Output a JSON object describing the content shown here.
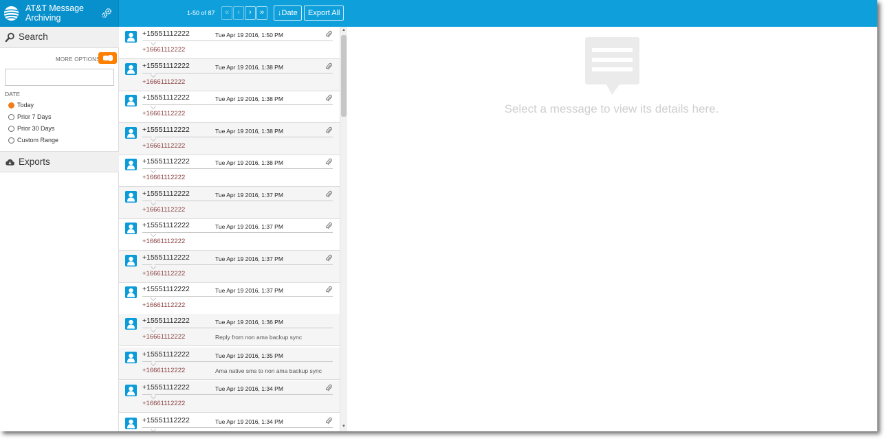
{
  "app": {
    "title": "AT&T Message Archiving"
  },
  "colors": {
    "header": "#0fa0dc",
    "accent": "#ff7f00",
    "avatar": "#0a9bd9",
    "recipient": "#8a3f3f"
  },
  "toolbar": {
    "page_count": "1-50 of 87",
    "first_icon": "«",
    "prev_icon": "‹",
    "next_icon": "›",
    "last_icon": "»",
    "sort_label": "Date",
    "export_all_label": "Export All"
  },
  "sidebar": {
    "search_label": "Search",
    "more_options_label": "MORE OPTIONS",
    "search_value": "",
    "date_label": "DATE",
    "date_options": [
      "Today",
      "Prior 7 Days",
      "Prior 30 Days",
      "Custom Range"
    ],
    "selected_date": "Today",
    "exports_label": "Exports"
  },
  "messages": [
    {
      "sender": "+15551112222",
      "date": "Tue Apr 19 2016, 1:50 PM",
      "recipient": "+16661112222",
      "snippet": "",
      "attachment": true
    },
    {
      "sender": "+15551112222",
      "date": "Tue Apr 19 2016, 1:38 PM",
      "recipient": "+16661112222",
      "snippet": "",
      "attachment": true
    },
    {
      "sender": "+15551112222",
      "date": "Tue Apr 19 2016, 1:38 PM",
      "recipient": "+16661112222",
      "snippet": "",
      "attachment": true
    },
    {
      "sender": "+15551112222",
      "date": "Tue Apr 19 2016, 1:38 PM",
      "recipient": "+16661112222",
      "snippet": "",
      "attachment": true
    },
    {
      "sender": "+15551112222",
      "date": "Tue Apr 19 2016, 1:38 PM",
      "recipient": "+16661112222",
      "snippet": "",
      "attachment": true
    },
    {
      "sender": "+15551112222",
      "date": "Tue Apr 19 2016, 1:37 PM",
      "recipient": "+16661112222",
      "snippet": "",
      "attachment": true
    },
    {
      "sender": "+15551112222",
      "date": "Tue Apr 19 2016, 1:37 PM",
      "recipient": "+16661112222",
      "snippet": "",
      "attachment": true
    },
    {
      "sender": "+15551112222",
      "date": "Tue Apr 19 2016, 1:37 PM",
      "recipient": "+16661112222",
      "snippet": "",
      "attachment": true
    },
    {
      "sender": "+15551112222",
      "date": "Tue Apr 19 2016, 1:37 PM",
      "recipient": "+16661112222",
      "snippet": "",
      "attachment": true
    },
    {
      "sender": "+15551112222",
      "date": "Tue Apr 19 2016, 1:36 PM",
      "recipient": "+16661112222",
      "snippet": "Reply from non ama backup sync",
      "attachment": false
    },
    {
      "sender": "+15551112222",
      "date": "Tue Apr 19 2016, 1:35 PM",
      "recipient": "+16661112222",
      "snippet": "Ama native sms to non ama backup sync",
      "attachment": false
    },
    {
      "sender": "+15551112222",
      "date": "Tue Apr 19 2016, 1:34 PM",
      "recipient": "+16661112222",
      "snippet": "",
      "attachment": true
    },
    {
      "sender": "+15551112222",
      "date": "Tue Apr 19 2016, 1:34 PM",
      "recipient": "",
      "snippet": "",
      "attachment": true
    }
  ],
  "detail": {
    "empty_text": "Select a message to view its details here."
  },
  "icons": {
    "logo": "att-globe-icon",
    "settings": "gears-icon",
    "search": "magnifier-icon",
    "exports": "cloud-download-icon",
    "avatar": "person-icon",
    "attachment": "paperclip-icon",
    "empty": "message-bubble-icon"
  }
}
